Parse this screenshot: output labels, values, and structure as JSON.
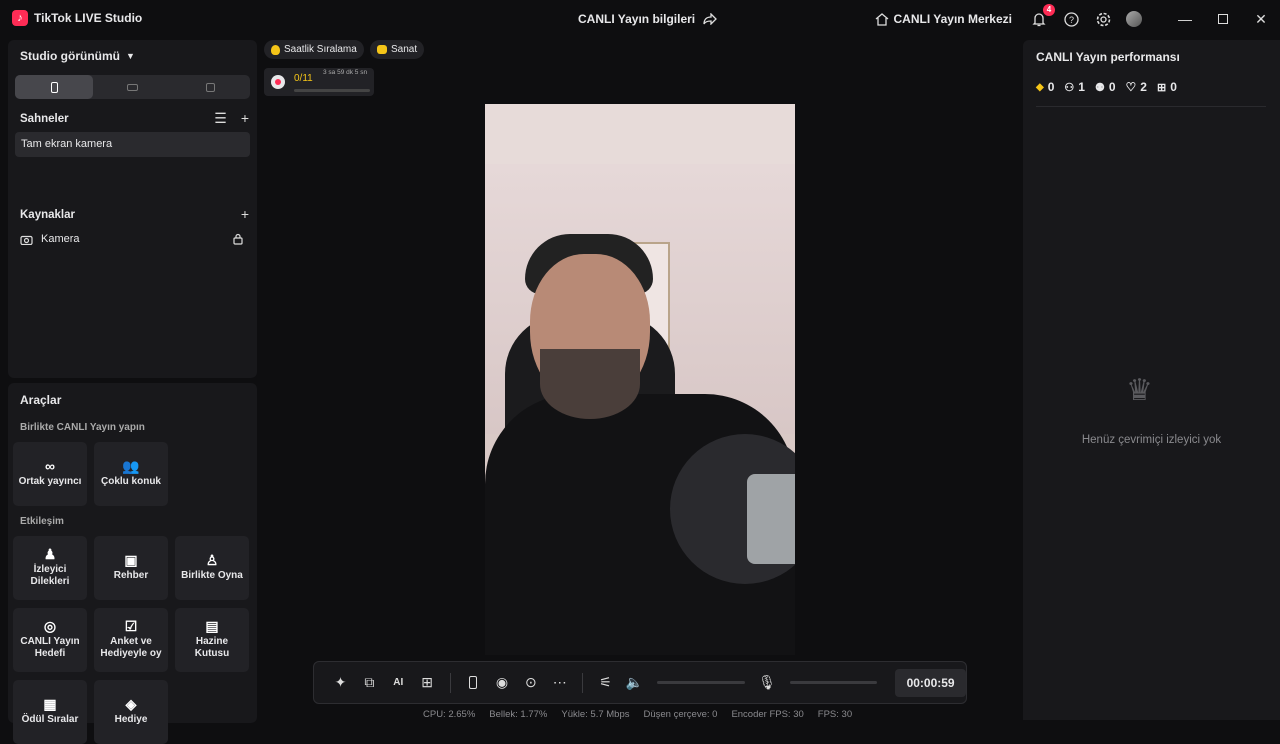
{
  "app": {
    "title": "TikTok LIVE Studio"
  },
  "header": {
    "stream_info": "CANLI Yayın bilgileri",
    "live_center": "CANLI Yayın Merkezi",
    "notif_count": "4"
  },
  "left": {
    "studio_view": "Studio görünümü",
    "scenes_title": "Sahneler",
    "scene_item": "Tam ekran kamera",
    "sources_title": "Kaynaklar",
    "source_item": "Kamera"
  },
  "tools": {
    "title": "Araçlar",
    "group1": "Birlikte CANLI Yayın yapın",
    "group2": "Etkileşim",
    "items": [
      {
        "label": "Ortak yayıncı",
        "icon": "link-icon"
      },
      {
        "label": "Çoklu konuk",
        "icon": "users-icon"
      },
      {
        "label": "İzleyici Dilekleri",
        "icon": "viewer-wish-icon"
      },
      {
        "label": "Rehber",
        "icon": "guide-icon"
      },
      {
        "label": "Birlikte Oyna",
        "icon": "play-together-icon"
      },
      {
        "label": "CANLI Yayın Hedefi",
        "icon": "target-icon"
      },
      {
        "label": "Anket ve Hediyeyle oy",
        "icon": "poll-icon"
      },
      {
        "label": "Hazine Kutusu",
        "icon": "treasure-icon"
      },
      {
        "label": "Ödül Sıralar",
        "icon": "ranking-icon"
      },
      {
        "label": "Hediye",
        "icon": "gift-icon"
      }
    ]
  },
  "top_pills": [
    {
      "label": "Saatlik Sıralama",
      "color": "#f5c518"
    },
    {
      "label": "Sanat",
      "color": "#f5c518"
    }
  ],
  "goal": {
    "progress": "0/11",
    "time": "3 sa 59 dk 5 sn"
  },
  "controls": {
    "timer": "00:00:59"
  },
  "stats": [
    "CPU: 2.65%",
    "Bellek: 1.77%",
    "Yükle: 5.7 Mbps",
    "Düşen çerçeve: 0",
    "Encoder FPS: 30",
    "FPS: 30"
  ],
  "performance": {
    "title": "CANLI Yayın performansı",
    "diamonds": "0",
    "viewers": "1",
    "new_followers": "0",
    "likes": "2",
    "gifts": "0",
    "empty_text": "Henüz çevrimiçi izleyici yok"
  }
}
